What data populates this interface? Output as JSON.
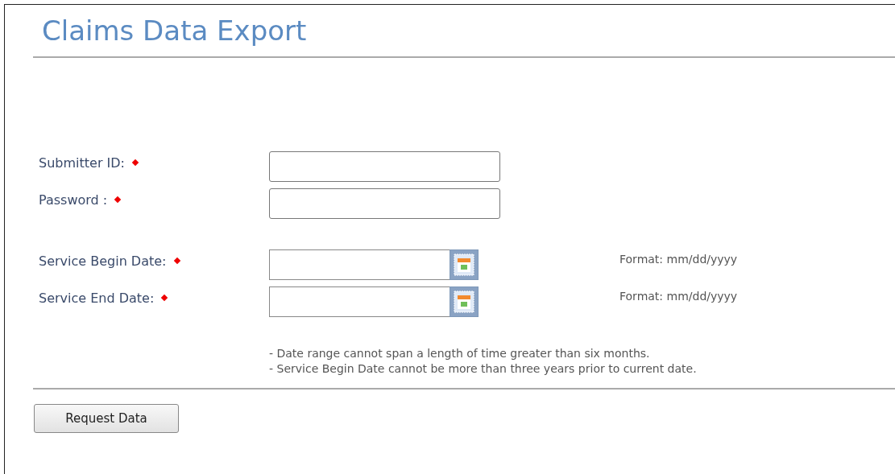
{
  "page": {
    "title": "Claims Data Export"
  },
  "credentials": [
    {
      "label": "Submitter ID:",
      "required": true
    },
    {
      "label": "Password :",
      "required": true
    }
  ],
  "dates": [
    {
      "label": "Service Begin Date:",
      "required": true,
      "kind": "date",
      "hint": "Format: mm/dd/yyyy"
    },
    {
      "label": "Service End Date:",
      "required": true,
      "kind": "date",
      "hint": "Format: mm/dd/yyyy"
    }
  ],
  "notes": [
    "- Date range cannot span a length of time greater than six months.",
    "- Service Begin Date cannot be more than three years prior to current date."
  ],
  "submit_button": "Request Data"
}
